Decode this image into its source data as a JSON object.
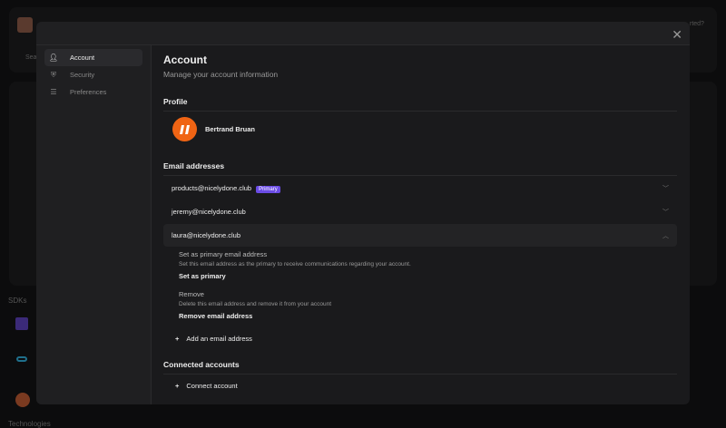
{
  "background": {
    "help_text": "rted?",
    "search_text": "Sea",
    "sdks_heading": "SDKs",
    "technologies_heading": "Technologies"
  },
  "sidebar": {
    "items": [
      {
        "label": "Account",
        "icon": "user-icon"
      },
      {
        "label": "Security",
        "icon": "shield-icon"
      },
      {
        "label": "Preferences",
        "icon": "sliders-icon"
      }
    ]
  },
  "main": {
    "title": "Account",
    "subtitle": "Manage your account information",
    "profile": {
      "heading": "Profile",
      "name": "Bertrand Bruan"
    },
    "emails": {
      "heading": "Email addresses",
      "primary_badge": "Primary",
      "items": [
        "products@nicelydone.club",
        "jeremy@nicelydone.club",
        "laura@nicelydone.club"
      ],
      "set_primary_title": "Set as primary email address",
      "set_primary_desc": "Set this email address as the primary to receive communications regarding your account.",
      "set_primary_action": "Set as primary",
      "remove_title": "Remove",
      "remove_desc": "Delete this email address and remove it from your account",
      "remove_action": "Remove email address",
      "add_label": "Add an email address"
    },
    "connected": {
      "heading": "Connected accounts",
      "connect_label": "Connect account"
    }
  },
  "colors": {
    "accent": "#6b4ce6",
    "avatar": "#f06414"
  }
}
